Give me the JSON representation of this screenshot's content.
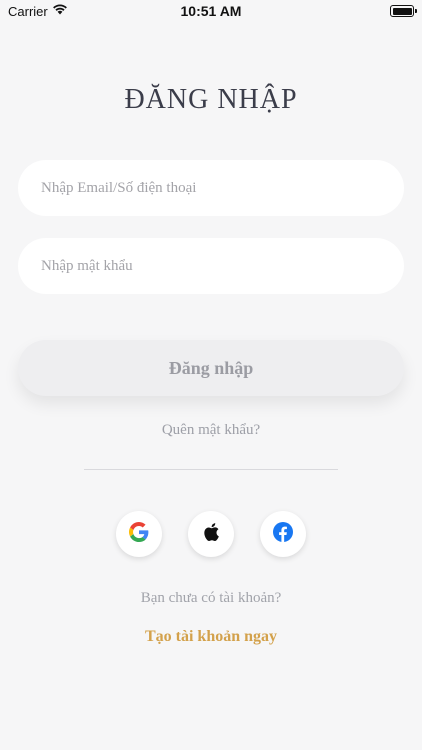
{
  "status_bar": {
    "carrier": "Carrier",
    "time": "10:51 AM"
  },
  "login": {
    "title": "ĐĂNG NHẬP",
    "email_placeholder": "Nhập Email/Số điện thoại",
    "password_placeholder": "Nhập mật khẩu",
    "submit_label": "Đăng nhập",
    "forgot_password": "Quên mật khẩu?",
    "no_account": "Bạn chưa có tài khoản?",
    "create_account": "Tạo tài khoản ngay"
  },
  "social_buttons": [
    {
      "icon": "google-icon"
    },
    {
      "icon": "apple-icon"
    },
    {
      "icon": "facebook-icon"
    }
  ],
  "colors": {
    "background": "#f6f6f7",
    "title": "#3b3d4a",
    "link_accent": "#d3a14b",
    "facebook_blue": "#1877f2"
  }
}
